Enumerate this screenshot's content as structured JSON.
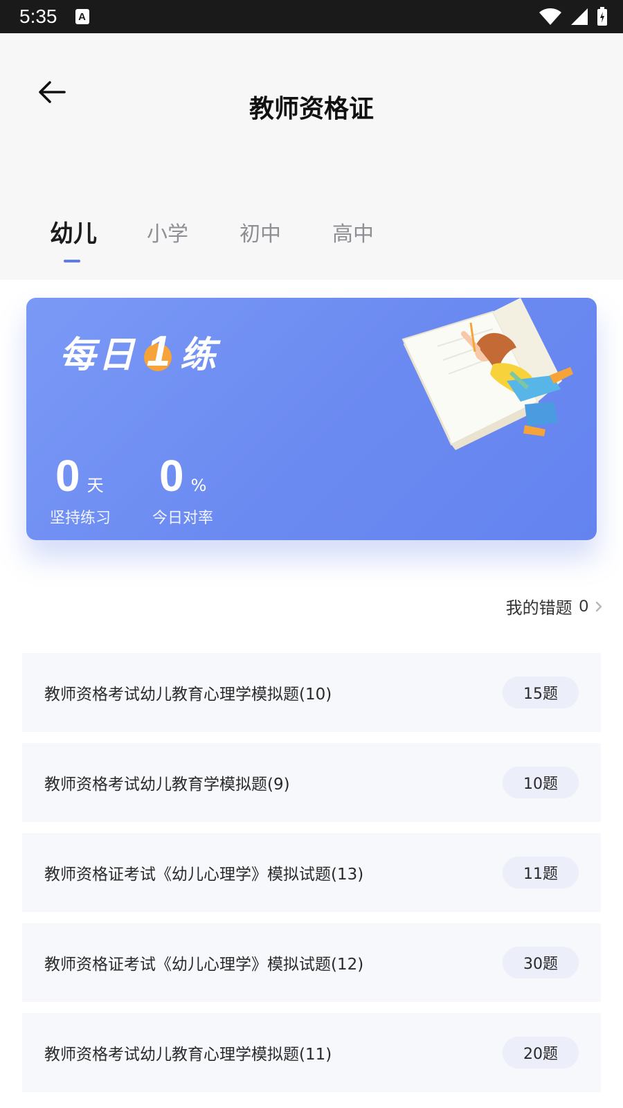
{
  "status_bar": {
    "time": "5:35",
    "notification_glyph": "A",
    "icons": [
      "wifi-icon",
      "signal-icon",
      "battery-icon"
    ]
  },
  "header": {
    "title": "教师资格证",
    "back_icon": "arrow-left-icon"
  },
  "tabs": [
    {
      "label": "幼儿",
      "active": true
    },
    {
      "label": "小学",
      "active": false
    },
    {
      "label": "初中",
      "active": false
    },
    {
      "label": "高中",
      "active": false
    }
  ],
  "daily_card": {
    "title_part1": "每日",
    "title_number": "1",
    "title_part2": "练",
    "stats": {
      "days": {
        "value": "0",
        "unit": "天",
        "label": "坚持练习"
      },
      "rate": {
        "value": "0",
        "unit": "%",
        "label": "今日对率"
      }
    },
    "colors": {
      "card": "#6b8af1",
      "accent": "#f6a33a"
    }
  },
  "wrong_questions": {
    "label": "我的错题",
    "count": "0"
  },
  "question_sets": [
    {
      "title": "教师资格考试幼儿教育心理学模拟题(10)",
      "count": "15题"
    },
    {
      "title": "教师资格考试幼儿教育学模拟题(9)",
      "count": "10题"
    },
    {
      "title": "教师资格证考试《幼儿心理学》模拟试题(13)",
      "count": "11题"
    },
    {
      "title": "教师资格证考试《幼儿心理学》模拟试题(12)",
      "count": "30题"
    },
    {
      "title": "教师资格考试幼儿教育心理学模拟题(11)",
      "count": "20题"
    }
  ]
}
